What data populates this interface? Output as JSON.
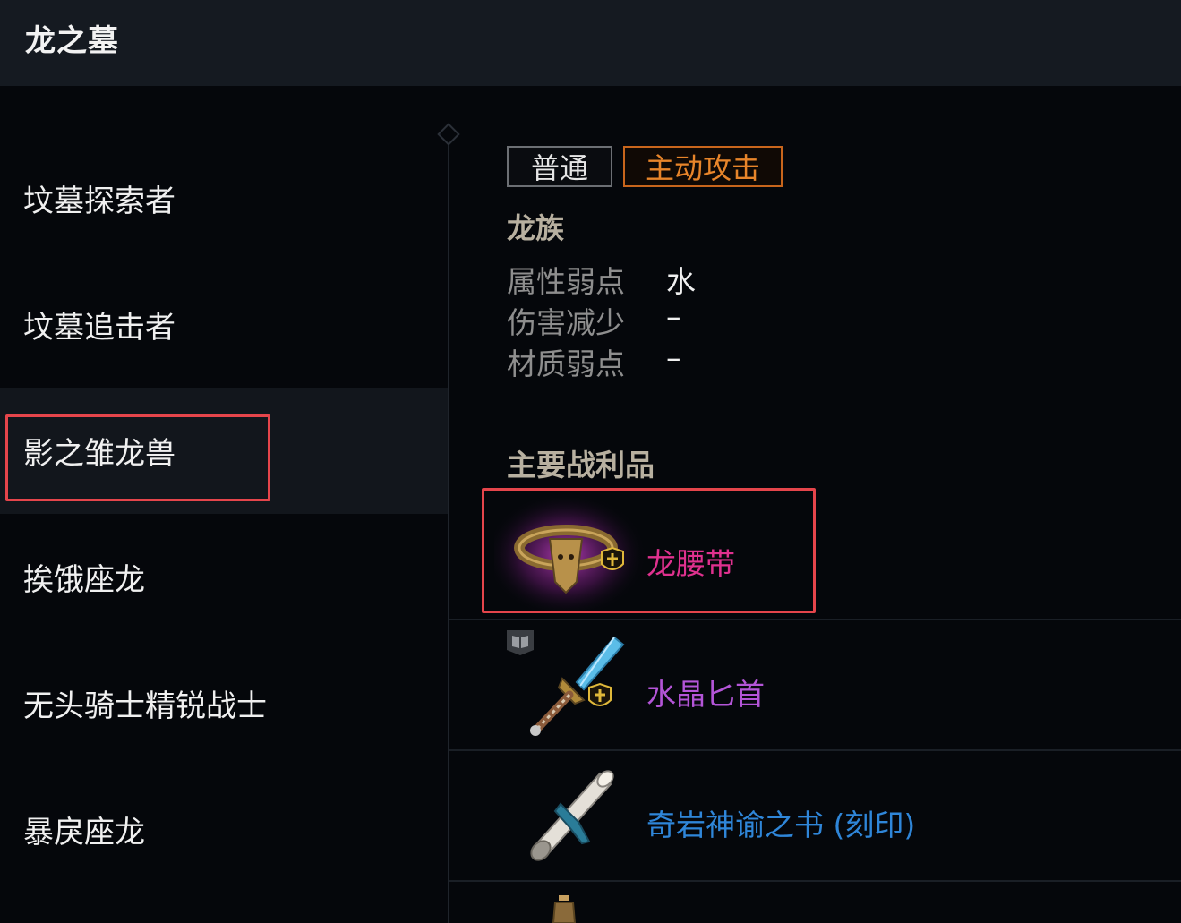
{
  "header": {
    "title": "龙之墓"
  },
  "sidebar": {
    "items": [
      {
        "label": "坟墓探索者"
      },
      {
        "label": "坟墓追击者"
      },
      {
        "label": "影之雏龙兽"
      },
      {
        "label": "挨饿座龙"
      },
      {
        "label": "无头骑士精锐战士"
      },
      {
        "label": "暴戾座龙"
      }
    ],
    "selected_label": "影之雏龙兽"
  },
  "detail": {
    "tabs": [
      {
        "label": "普通"
      },
      {
        "label": "主动攻击"
      }
    ],
    "active_tab": "主动攻击",
    "race": "龙族",
    "attributes": [
      {
        "key": "属性弱点",
        "value": "水"
      },
      {
        "key": "伤害减少",
        "value": "–"
      },
      {
        "key": "材质弱点",
        "value": "–"
      }
    ],
    "loot_title": "主要战利品",
    "loot": [
      {
        "name": "龙腰带",
        "color": "#e0318f",
        "icon": "dragon-belt-icon"
      },
      {
        "name": "水晶匕首",
        "color": "#b455d8",
        "icon": "crystal-dagger-icon"
      },
      {
        "name": "奇岩神谕之书 (刻印)",
        "color": "#2f86d9",
        "icon": "scroll-icon"
      }
    ]
  },
  "colors": {
    "accent": "#e8852a",
    "highlight_box": "#e5454b"
  }
}
